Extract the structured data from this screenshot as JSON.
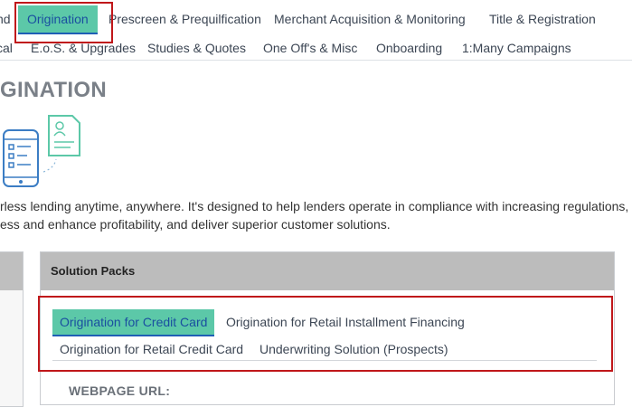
{
  "nav": {
    "row1": [
      {
        "label": "nd"
      },
      {
        "label": "Origination"
      },
      {
        "label": "Prescreen & Prequilfication"
      },
      {
        "label": "Merchant Acquisition & Monitoring"
      },
      {
        "label": "Title & Registration"
      }
    ],
    "row2": [
      {
        "label": "cal"
      },
      {
        "label": "E.o.S. & Upgrades"
      },
      {
        "label": "Studies & Quotes"
      },
      {
        "label": "One Off's & Misc"
      },
      {
        "label": "Onboarding"
      },
      {
        "label": "1:Many Campaigns"
      }
    ],
    "active": "Origination"
  },
  "page": {
    "title": "GINATION",
    "intro_line1": "rless lending anytime, anywhere. It's designed to help lenders operate in compliance with increasing regulations,",
    "intro_line2": "ess and enhance profitability, and deliver superior customer solutions."
  },
  "solution_packs": {
    "header": "Solution Packs",
    "tabs": [
      {
        "label": "Origination for Credit Card",
        "active": true
      },
      {
        "label": "Origination for Retail Installment Financing",
        "active": false
      },
      {
        "label": "Origination for Retail Credit Card",
        "active": false
      },
      {
        "label": "Underwriting Solution (Prospects)",
        "active": false
      }
    ],
    "webpage_url_label": "WEBPAGE URL:"
  },
  "colors": {
    "active_tab_bg": "#5cc8a8",
    "active_tab_text": "#1a4fa0",
    "highlight_box": "#c0171a",
    "panel_header_bg": "#bcbcbc"
  }
}
